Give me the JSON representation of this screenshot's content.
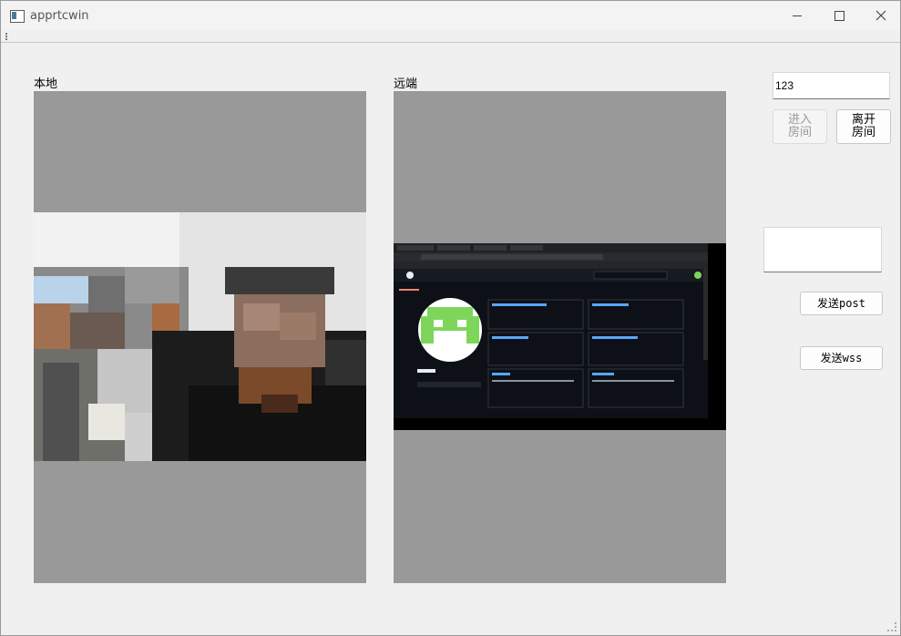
{
  "window": {
    "title": "apprtcwin"
  },
  "local": {
    "label": "本地"
  },
  "remote": {
    "label": "远端"
  },
  "controls": {
    "room_input_value": "123",
    "join_button": "进入\n房间",
    "leave_button": "离开\n房间",
    "message_input_value": "",
    "send_post_button": "发送post",
    "send_wss_button": "发送wss"
  },
  "colors": {
    "video_bg": "#999999",
    "remote_screen_bg": "#0d1117"
  }
}
